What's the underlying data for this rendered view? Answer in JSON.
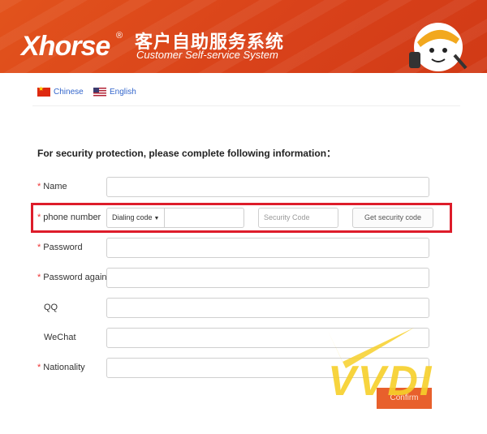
{
  "header": {
    "brand": "Xhorse",
    "registered": "®",
    "title_cn": "客户自助服务系统",
    "title_en": "Customer Self-service System",
    "mascot_icon": "mascot-icon",
    "bg_color": "#d9431a"
  },
  "languages": [
    {
      "label": "Chinese",
      "icon": "cn-flag-icon"
    },
    {
      "label": "English",
      "icon": "us-flag-icon"
    }
  ],
  "form": {
    "instruction": "For security protection, please complete following information：",
    "required_mark": "*",
    "fields": {
      "name": {
        "label": "Name",
        "value": ""
      },
      "phone": {
        "label": "phone number",
        "dial_code": "Dialing code",
        "value": "",
        "security_placeholder": "Security Code",
        "get_code_label": "Get security code"
      },
      "password": {
        "label": "Password",
        "value": ""
      },
      "password_again": {
        "label": "Password again",
        "value": ""
      },
      "qq": {
        "label": "QQ",
        "value": ""
      },
      "wechat": {
        "label": "WeChat",
        "value": ""
      },
      "nationality": {
        "label": "Nationality",
        "value": ""
      }
    },
    "confirm_label": "Confirm"
  },
  "watermark": {
    "text": "VVDI",
    "color": "#f7d02a"
  },
  "highlight_color": "#dd1c2a"
}
